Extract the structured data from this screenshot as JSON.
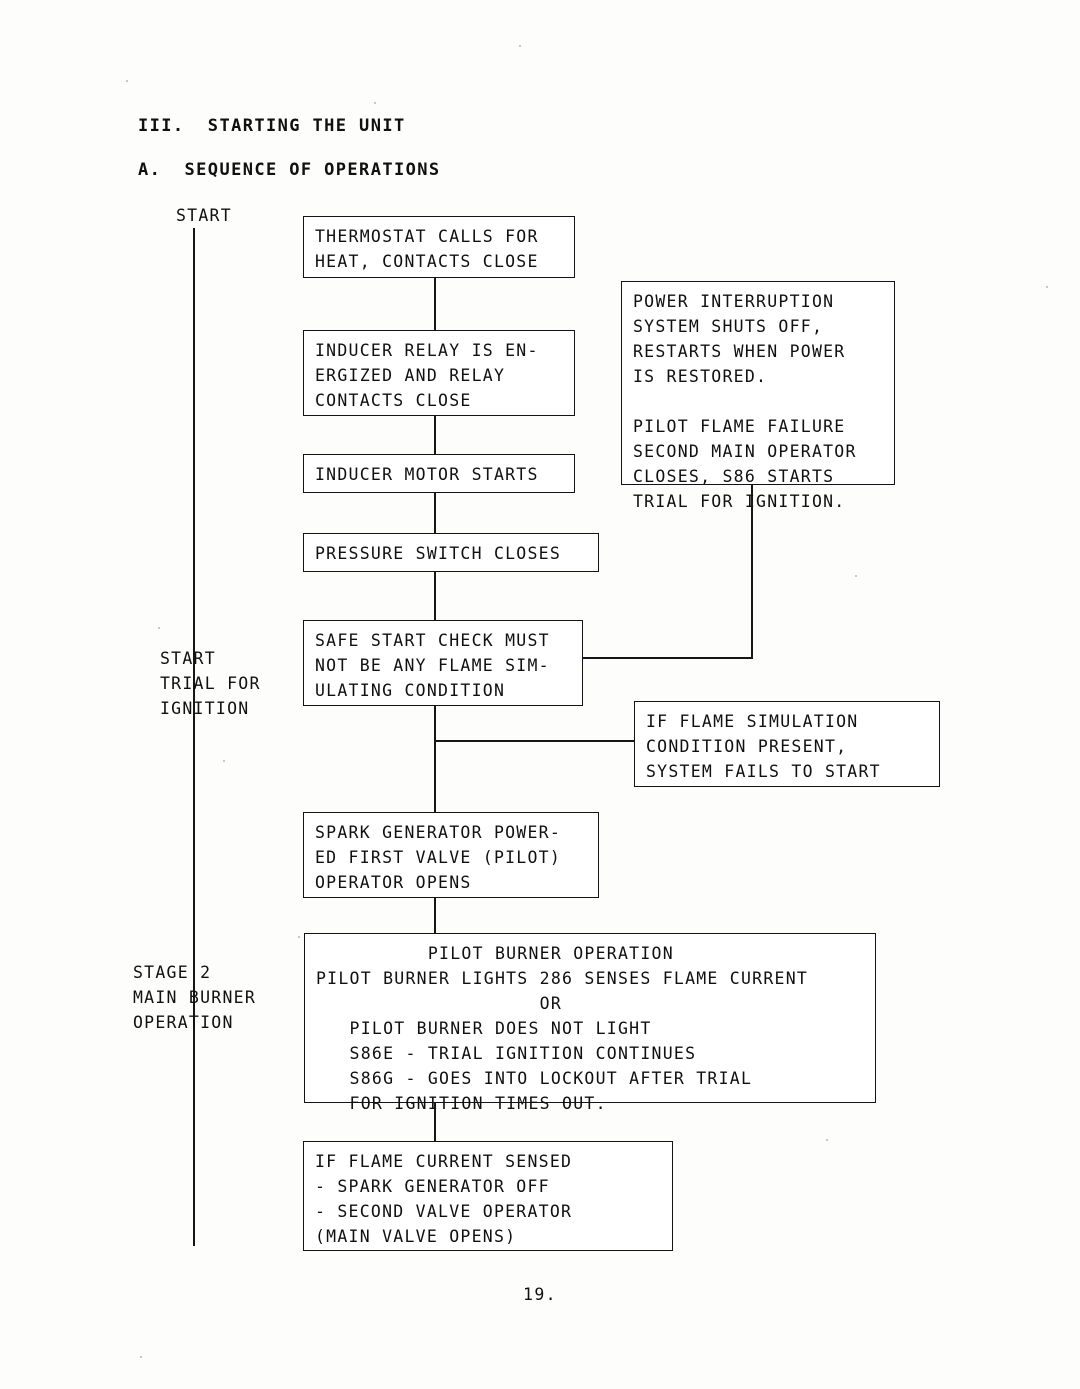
{
  "document": {
    "section_heading": "III.  STARTING THE UNIT",
    "subsection_heading": "A.  SEQUENCE OF OPERATIONS",
    "page_number": "19."
  },
  "stage_labels": {
    "start": "START",
    "trial_for_ignition": "START\nTRIAL FOR\nIGNITION",
    "stage_two": "STAGE 2\nMAIN BURNER\nOPERATION"
  },
  "flowchart": {
    "type": "flowchart",
    "boxes": [
      {
        "id": "thermostat",
        "text": "THERMOSTAT CALLS FOR\nHEAT, CONTACTS CLOSE",
        "align": "left"
      },
      {
        "id": "inducer-relay",
        "text": "INDUCER RELAY IS EN-\nERGIZED AND RELAY\nCONTACTS CLOSE",
        "align": "left"
      },
      {
        "id": "inducer-motor",
        "text": "INDUCER MOTOR STARTS",
        "align": "left"
      },
      {
        "id": "pressure-switch",
        "text": "PRESSURE SWITCH CLOSES",
        "align": "left"
      },
      {
        "id": "safe-start-check",
        "text": "SAFE START CHECK MUST\nNOT BE ANY FLAME SIM-\nULATING CONDITION",
        "align": "left"
      },
      {
        "id": "power-interruption",
        "text": "POWER INTERRUPTION\nSYSTEM SHUTS OFF,\nRESTARTS WHEN POWER\nIS RESTORED.\n\nPILOT FLAME FAILURE\nSECOND MAIN OPERATOR\nCLOSES, S86 STARTS\nTRIAL FOR IGNITION.",
        "align": "left"
      },
      {
        "id": "flame-simulation",
        "text": "IF FLAME SIMULATION\nCONDITION PRESENT,\nSYSTEM FAILS TO START",
        "align": "left"
      },
      {
        "id": "spark-generator",
        "text": "SPARK GENERATOR POWER-\nED FIRST VALVE (PILOT)\nOPERATOR OPENS",
        "align": "left"
      },
      {
        "id": "pilot-burner-operation",
        "text": "          PILOT BURNER OPERATION\nPILOT BURNER LIGHTS 286 SENSES FLAME CURRENT\n                    OR\n   PILOT BURNER DOES NOT LIGHT\n   S86E - TRIAL IGNITION CONTINUES\n   S86G - GOES INTO LOCKOUT AFTER TRIAL\n   FOR IGNITION TIMES OUT.",
        "align": "left"
      },
      {
        "id": "flame-current-sensed",
        "text": "IF FLAME CURRENT SENSED\n- SPARK GENERATOR OFF\n- SECOND VALVE OPERATOR\n(MAIN VALVE OPENS)",
        "align": "left"
      }
    ]
  }
}
